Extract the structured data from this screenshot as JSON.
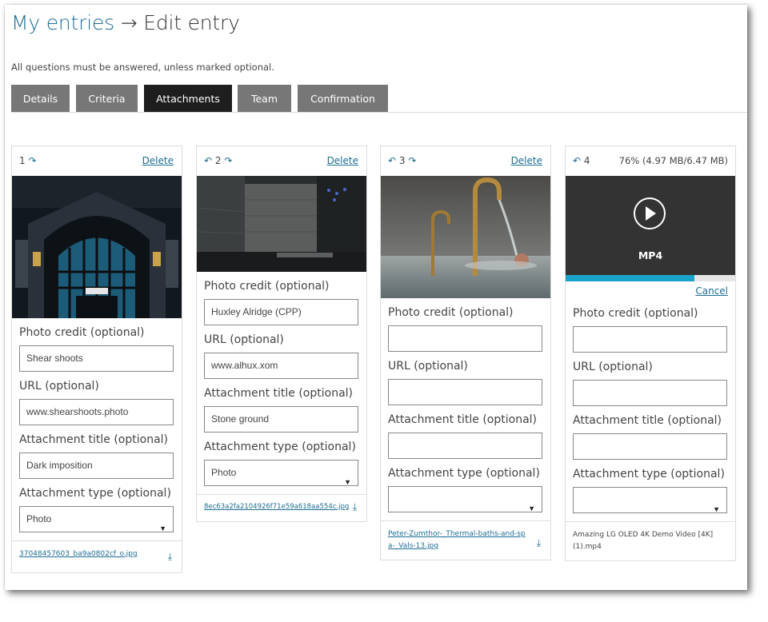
{
  "header": {
    "breadcrumb_link": "My entries",
    "arrow": "→",
    "page_title": "Edit entry"
  },
  "notice": "All questions must be answered, unless marked optional.",
  "tabs": [
    {
      "label": "Details",
      "active": false
    },
    {
      "label": "Criteria",
      "active": false
    },
    {
      "label": "Attachments",
      "active": true
    },
    {
      "label": "Team",
      "active": false
    },
    {
      "label": "Confirmation",
      "active": false
    }
  ],
  "labels": {
    "photo_credit": "Photo credit (optional)",
    "url": "URL (optional)",
    "attachment_title": "Attachment title (optional)",
    "attachment_type": "Attachment type (optional)",
    "delete": "Delete",
    "cancel": "Cancel"
  },
  "attachments": [
    {
      "index": "1",
      "photo_credit": "Shear shoots",
      "url": "www.shearshoots.photo",
      "title": "Dark imposition",
      "type": "Photo",
      "filename": "37048457603_ba9a0802cf_o.jpg"
    },
    {
      "index": "2",
      "photo_credit": "Huxley Alridge (CPP)",
      "url": "www.alhux.xom",
      "title": "Stone ground",
      "type": "Photo",
      "filename": "8ec63a2fa2104926f71e59a618aa554c.jpg"
    },
    {
      "index": "3",
      "photo_credit": "",
      "url": "",
      "title": "",
      "type": "",
      "filename": "Peter-Zumthor-_Thermal-baths-and-spa-_Vals-13.jpg"
    },
    {
      "index": "4",
      "progress_text": "76% (4.97 MB/6.47 MB)",
      "progress": 0.76,
      "format": "MP4",
      "photo_credit": "",
      "url": "",
      "title": "",
      "type": "",
      "filename": "Amazing LG OLED 4K Demo Video [4K] (1).mp4"
    }
  ],
  "colors": {
    "accent": "#1e6d94",
    "tab_bg": "#777777",
    "tab_active_bg": "#1e1e1e",
    "progress_fill": "#1aa3c9",
    "video_bg": "#333333"
  },
  "icons": {
    "move_left": "arrow-left-curved-icon",
    "move_right": "arrow-right-curved-icon",
    "download": "download-icon",
    "play": "play-icon",
    "dropdown": "caret-down-icon"
  }
}
